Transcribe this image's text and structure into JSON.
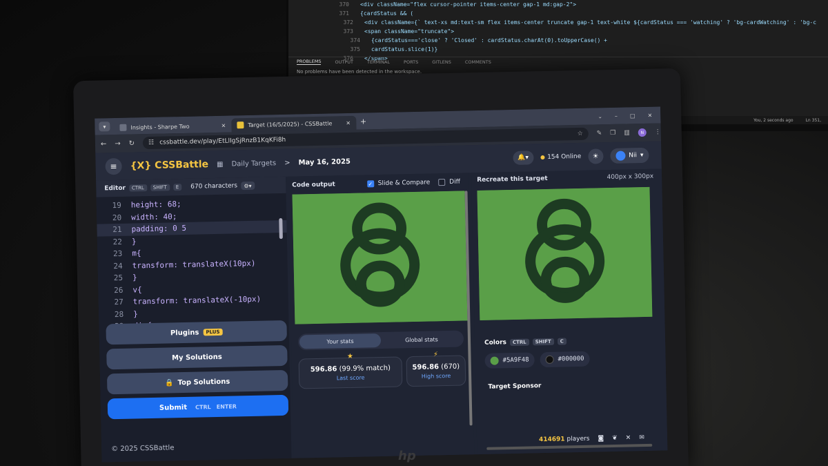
{
  "monitor": {
    "code_lines": [
      {
        "ln": "370",
        "text": "<div className=\"flex cursor-pointer items-center gap-1 md:gap-2\">"
      },
      {
        "ln": "371",
        "text": "{cardStatus && ("
      },
      {
        "ln": "372",
        "text": "<div className={` text-xs md:text-sm flex items-center truncate gap-1 text-white ${cardStatus === 'watching' ? 'bg-cardWatching' : 'bg-c"
      },
      {
        "ln": "373",
        "text": "<span className=\"truncate\">"
      },
      {
        "ln": "374",
        "text": "{cardStatus==='close' ? 'Closed' : cardStatus.charAt(0).toUpperCase() +"
      },
      {
        "ln": "375",
        "text": "cardStatus.slice(1)}"
      },
      {
        "ln": "376",
        "text": "</span>"
      }
    ],
    "panel_tabs": [
      "PROBLEMS",
      "OUTPUT",
      "TERMINAL",
      "PORTS",
      "GITLENS",
      "COMMENTS"
    ],
    "panel_message": "No problems have been detected in the workspace.",
    "status_left": "You, 2 seconds ago",
    "status_right": "Ln 351,"
  },
  "browser": {
    "tabs": [
      {
        "title": "Insights - Sharpe Two",
        "active": false
      },
      {
        "title": "Target (16/5/2025) - CSSBattle",
        "active": true
      }
    ],
    "url": "cssbattle.dev/play/EtLlIgSjRnzB1KqKFi8h",
    "profile_initial": "N"
  },
  "header": {
    "logo": "{X} CSSBattle",
    "crumb_daily": "Daily Targets",
    "crumb_sep": ">",
    "crumb_date": "May 16, 2025",
    "online_count": "154 Online",
    "user_name": "Nii"
  },
  "editor": {
    "title": "Editor",
    "shortcut_keys": [
      "CTRL",
      "SHIFT",
      "E"
    ],
    "char_count": "670 characters",
    "lines": [
      {
        "n": "19",
        "code": "height: 68;"
      },
      {
        "n": "20",
        "code": "width: 40;"
      },
      {
        "n": "21",
        "code": "padding: 0 5"
      },
      {
        "n": "22",
        "code": "}"
      },
      {
        "n": "23",
        "code": "m{"
      },
      {
        "n": "24",
        "code": "transform: translateX(10px)"
      },
      {
        "n": "25",
        "code": "}"
      },
      {
        "n": "26",
        "code": "v{"
      },
      {
        "n": "27",
        "code": "transform: translateX(-10px)"
      },
      {
        "n": "28",
        "code": "}"
      },
      {
        "n": "29",
        "code": "div{"
      }
    ],
    "buttons": {
      "plugins": "Plugins",
      "plugins_badge": "PLUS",
      "my_solutions": "My Solutions",
      "top_solutions": "Top Solutions",
      "submit": "Submit",
      "submit_keys": [
        "CTRL",
        "ENTER"
      ]
    },
    "copyright": "© 2025 CSSBattle"
  },
  "output": {
    "title": "Code output",
    "slide_compare": "Slide & Compare",
    "slide_compare_checked": true,
    "diff": "Diff",
    "diff_checked": false,
    "stat_tabs": [
      "Your stats",
      "Global stats"
    ],
    "last_score_value": "596.86",
    "last_score_match": "(99.9% match)",
    "last_score_label": "Last score",
    "high_score_value": "596.86",
    "high_score_extra": "(670)",
    "high_score_label": "High score"
  },
  "target": {
    "title": "Recreate this target",
    "size": "400px x 300px",
    "colors_label": "Colors",
    "color_keys": [
      "CTRL",
      "SHIFT",
      "C"
    ],
    "colors": [
      {
        "hex": "#5A9F48",
        "value": "#5a9f48"
      },
      {
        "hex": "#000000",
        "value": "#1d3b22"
      }
    ],
    "sponsor_label": "Target Sponsor",
    "players": "414691",
    "players_suffix": "players"
  },
  "palette": {
    "canvas_green": "#5a9f48",
    "shape_dark": "#1d3b22",
    "accent_yellow": "#f5c542",
    "submit_blue": "#1d6ff2"
  }
}
